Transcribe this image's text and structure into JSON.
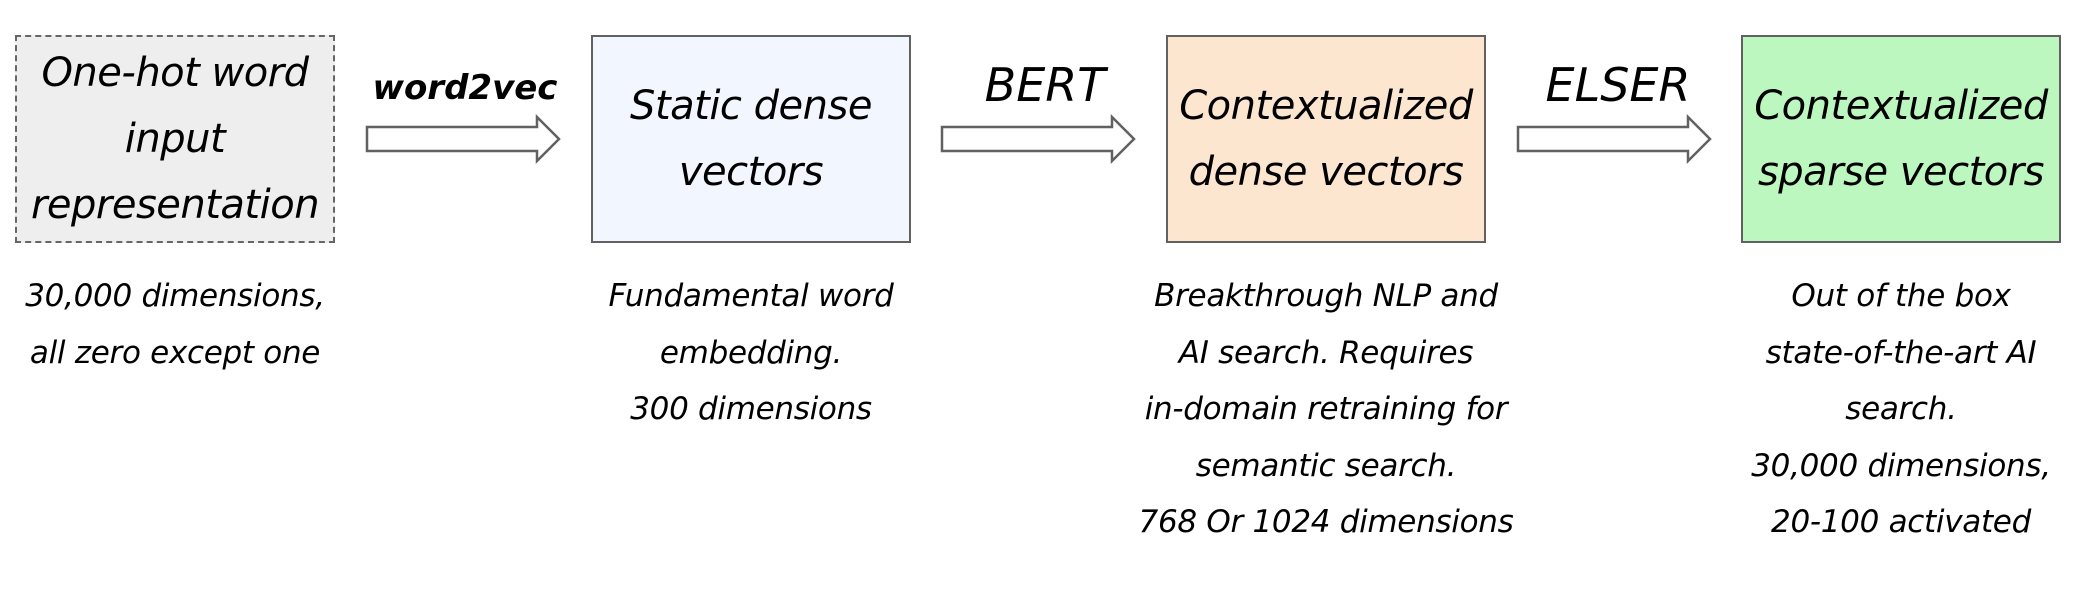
{
  "stages": [
    {
      "title": "One-hot word\ninput\nrepresentation",
      "fill": "#eeeeee",
      "border_style": "dashed",
      "description": [
        "30,000 dimensions,",
        "all zero except one"
      ]
    },
    {
      "title": "Static dense\nvectors",
      "fill": "#f2f7ff",
      "border_style": "solid",
      "description": [
        "Fundamental word",
        "embedding.",
        "300 dimensions"
      ]
    },
    {
      "title": "Contextualized\ndense vectors",
      "fill": "#fde6d0",
      "border_style": "solid",
      "description": [
        "Breakthrough NLP and",
        "AI search. Requires",
        "in-domain retraining for",
        "semantic search.",
        "768 Or 1024 dimensions"
      ]
    },
    {
      "title": "Contextualized\nsparse vectors",
      "fill": "#bdf7c0",
      "border_style": "solid",
      "description": [
        "Out of the box",
        "state-of-the-art AI",
        "search.",
        "30,000 dimensions,",
        "20-100 activated"
      ]
    }
  ],
  "transitions": [
    {
      "label": "word2vec",
      "from": "One-hot word input representation",
      "to": "Static dense vectors"
    },
    {
      "label": "BERT",
      "from": "Static dense vectors",
      "to": "Contextualized dense vectors"
    },
    {
      "label": "ELSER",
      "from": "Contextualized dense vectors",
      "to": "Contextualized sparse vectors"
    }
  ],
  "colors": {
    "border": "#616161",
    "arrow_stroke": "#616161",
    "arrow_fill": "#ffffff",
    "text": "#000000"
  }
}
